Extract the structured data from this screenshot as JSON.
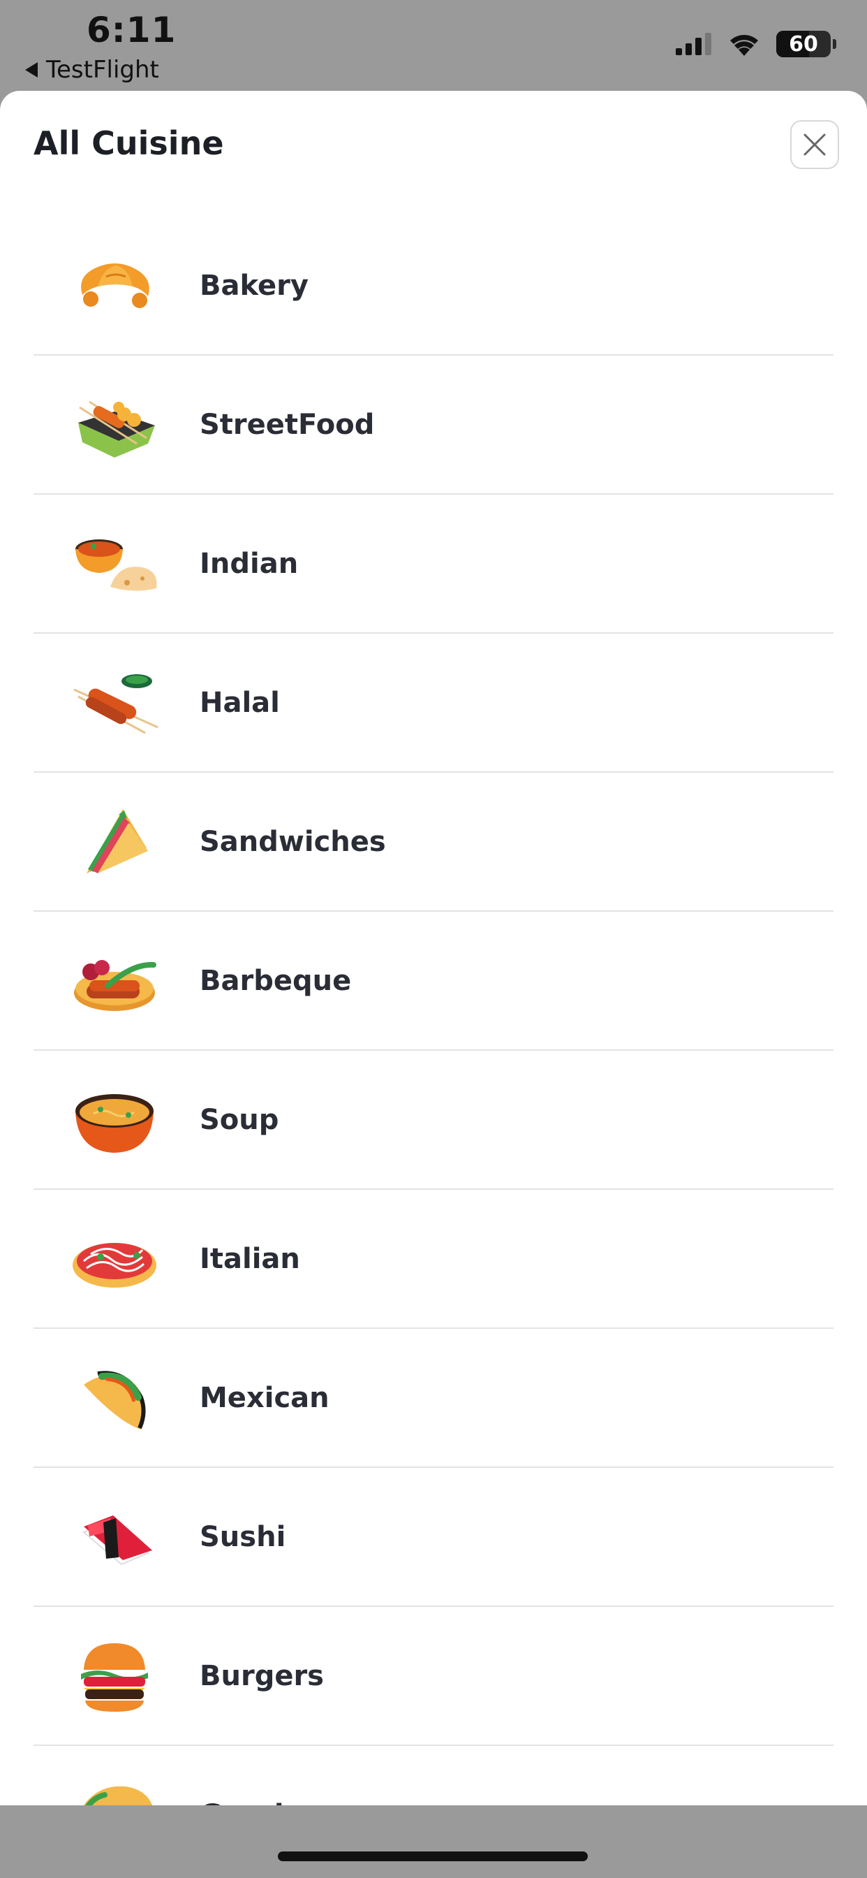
{
  "status_bar": {
    "time": "6:11",
    "back_app": "TestFlight",
    "battery": "60",
    "battery_level": 0.6,
    "icons": [
      "cellular-signal-icon",
      "wifi-icon",
      "battery-icon"
    ]
  },
  "sheet": {
    "title": "All Cuisine",
    "close_icon": "close-icon"
  },
  "cuisines": [
    {
      "label": "Bakery",
      "icon": "croissant-icon"
    },
    {
      "label": "StreetFood",
      "icon": "grill-skewers-icon"
    },
    {
      "label": "Indian",
      "icon": "curry-naan-icon"
    },
    {
      "label": "Halal",
      "icon": "kebab-icon"
    },
    {
      "label": "Sandwiches",
      "icon": "sandwich-icon"
    },
    {
      "label": "Barbeque",
      "icon": "bbq-plate-icon"
    },
    {
      "label": "Soup",
      "icon": "soup-bowl-icon"
    },
    {
      "label": "Italian",
      "icon": "pasta-icon"
    },
    {
      "label": "Mexican",
      "icon": "taco-icon"
    },
    {
      "label": "Sushi",
      "icon": "sushi-icon"
    },
    {
      "label": "Burgers",
      "icon": "burger-icon"
    },
    {
      "label": "Greek",
      "icon": "gyro-icon"
    }
  ],
  "colors": {
    "overlay": "#9a9a9a",
    "sheet_bg": "#ffffff",
    "text": "#2a2d36",
    "divider": "#e3e3e3"
  }
}
